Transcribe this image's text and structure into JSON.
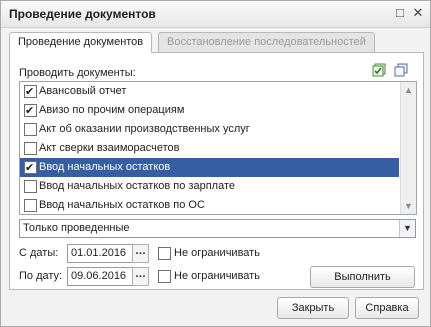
{
  "window": {
    "title": "Проведение документов",
    "maximize_glyph": "□",
    "close_glyph": "✕"
  },
  "tabs": [
    {
      "label": "Проведение документов",
      "active": true
    },
    {
      "label": "Восстановление последовательностей",
      "active": false
    }
  ],
  "section_label": "Проводить документы:",
  "toolbar_icons": [
    "check-all-icon",
    "copy-icon"
  ],
  "documents": [
    {
      "label": "Авансовый отчет",
      "checked": true,
      "selected": false
    },
    {
      "label": "Авизо по прочим операциям",
      "checked": true,
      "selected": false
    },
    {
      "label": "Акт об оказании производственных услуг",
      "checked": false,
      "selected": false
    },
    {
      "label": "Акт сверки взаиморасчетов",
      "checked": false,
      "selected": false
    },
    {
      "label": "Ввод начальных остатков",
      "checked": true,
      "selected": true
    },
    {
      "label": "Ввод начальных остатков по зарплате",
      "checked": false,
      "selected": false
    },
    {
      "label": "Ввод начальных остатков по ОС",
      "checked": false,
      "selected": false
    }
  ],
  "filter": {
    "value": "Только проведенные"
  },
  "date_from": {
    "label": "С даты:",
    "value": "01.01.2016",
    "unlimited_label": "Не ограничивать",
    "unlimited": false
  },
  "date_to": {
    "label": "По дату:",
    "value": "09.06.2016",
    "unlimited_label": "Не ограничивать",
    "unlimited": false
  },
  "buttons": {
    "execute": "Выполнить",
    "close": "Закрыть",
    "help": "Справка"
  },
  "colors": {
    "selection": "#355ea3",
    "tab_inactive_text": "#9a9a9a"
  }
}
